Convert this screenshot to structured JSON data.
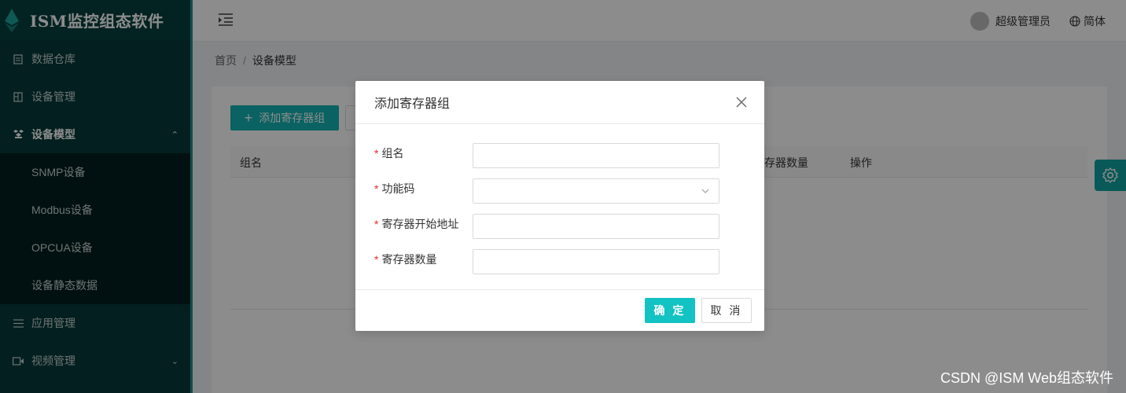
{
  "app": {
    "title": "ISM监控组态软件"
  },
  "sidebar": {
    "items": [
      {
        "label": "数据仓库",
        "icon": "database-icon"
      },
      {
        "label": "设备管理",
        "icon": "device-icon"
      },
      {
        "label": "设备模型",
        "icon": "model-icon",
        "expanded": true,
        "children": [
          "SNMP设备",
          "Modbus设备",
          "OPCUA设备",
          "设备静态数据"
        ]
      },
      {
        "label": "应用管理",
        "icon": "app-icon"
      },
      {
        "label": "视频管理",
        "icon": "video-icon"
      }
    ]
  },
  "header": {
    "user": "超级管理员",
    "language": "简体"
  },
  "breadcrumb": {
    "home": "首页",
    "sep": "/",
    "current": "设备模型"
  },
  "main": {
    "add_button": "添加寄存器组",
    "table_headers": [
      "组名",
      "寄存器数量",
      "操作"
    ]
  },
  "modal": {
    "title": "添加寄存器组",
    "fields": [
      {
        "label": "组名",
        "required": true,
        "type": "text",
        "value": ""
      },
      {
        "label": "功能码",
        "required": true,
        "type": "select",
        "value": ""
      },
      {
        "label": "寄存器开始地址",
        "required": true,
        "type": "text",
        "value": ""
      },
      {
        "label": "寄存器数量",
        "required": true,
        "type": "text",
        "value": ""
      }
    ],
    "ok_label": "确 定",
    "cancel_label": "取 消"
  },
  "watermark": "CSDN @ISM Web组态软件",
  "colors": {
    "sidebar": "#063a3a",
    "accent": "#13c2c2",
    "required": "#f5222d"
  }
}
